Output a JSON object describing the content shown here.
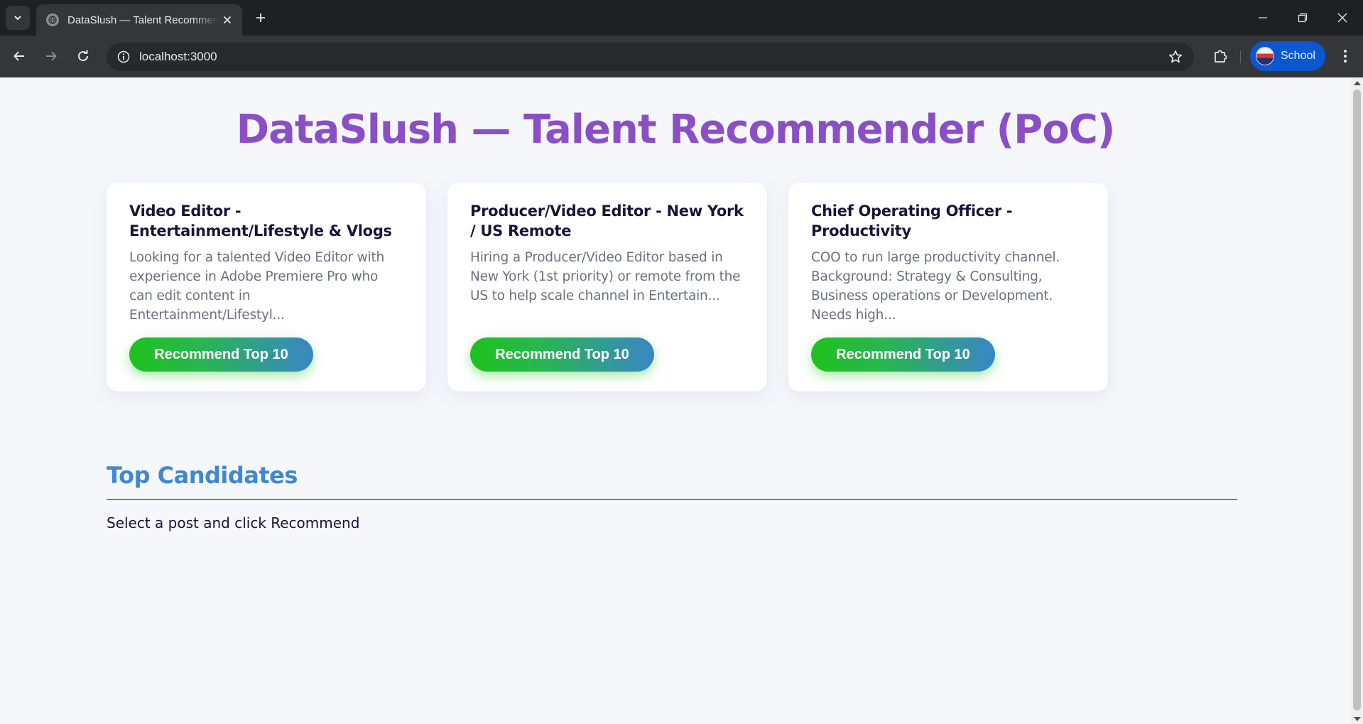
{
  "browser": {
    "tab": {
      "title": "DataSlush — Talent Recommender (PoC)"
    },
    "address_bar": {
      "url": "localhost:3000"
    },
    "profile": {
      "label": "School"
    }
  },
  "page": {
    "title": "DataSlush — Talent Recommender (PoC)",
    "posts": [
      {
        "title": "Video Editor - Entertainment/Lifestyle & Vlogs",
        "description": "Looking for a talented Video Editor with experience in Adobe Premiere Pro who can edit content in Entertainment/Lifestyl...",
        "button_label": "Recommend Top 10"
      },
      {
        "title": "Producer/Video Editor - New York / US Remote",
        "description": "Hiring a Producer/Video Editor based in New York (1st priority) or remote from the US to help scale channel in Entertain...",
        "button_label": "Recommend Top 10"
      },
      {
        "title": "Chief Operating Officer - Productivity",
        "description": "COO to run large productivity channel. Background: Strategy & Consulting, Business operations or Development. Needs high...",
        "button_label": "Recommend Top 10"
      }
    ],
    "candidates": {
      "heading": "Top Candidates",
      "empty_message": "Select a post and click Recommend"
    }
  },
  "colors": {
    "title": "#8a4fc6",
    "section_heading": "#3f88cf",
    "accent_green": "#1ec21e",
    "accent_blue": "#3a86c6"
  }
}
